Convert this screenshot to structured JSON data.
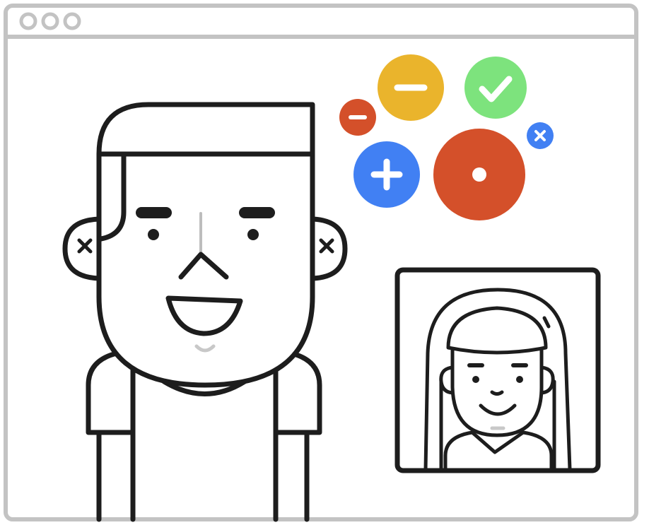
{
  "window": {
    "traffic_lights": [
      "circle-control-icon",
      "circle-control-icon",
      "circle-control-icon"
    ]
  },
  "reaction_bubbles": [
    {
      "icon": "minus-icon",
      "color": "#d4502a"
    },
    {
      "icon": "minus-icon",
      "color": "#eab42c"
    },
    {
      "icon": "check-icon",
      "color": "#7de37d"
    },
    {
      "icon": "plus-icon",
      "color": "#4180f3"
    },
    {
      "icon": "record-icon",
      "color": "#d4502a"
    },
    {
      "icon": "close-icon",
      "color": "#4180f3"
    }
  ],
  "colors": {
    "frame": "#c3c3c3",
    "stroke": "#1d1d1d",
    "chin": "#c8c8c8"
  }
}
